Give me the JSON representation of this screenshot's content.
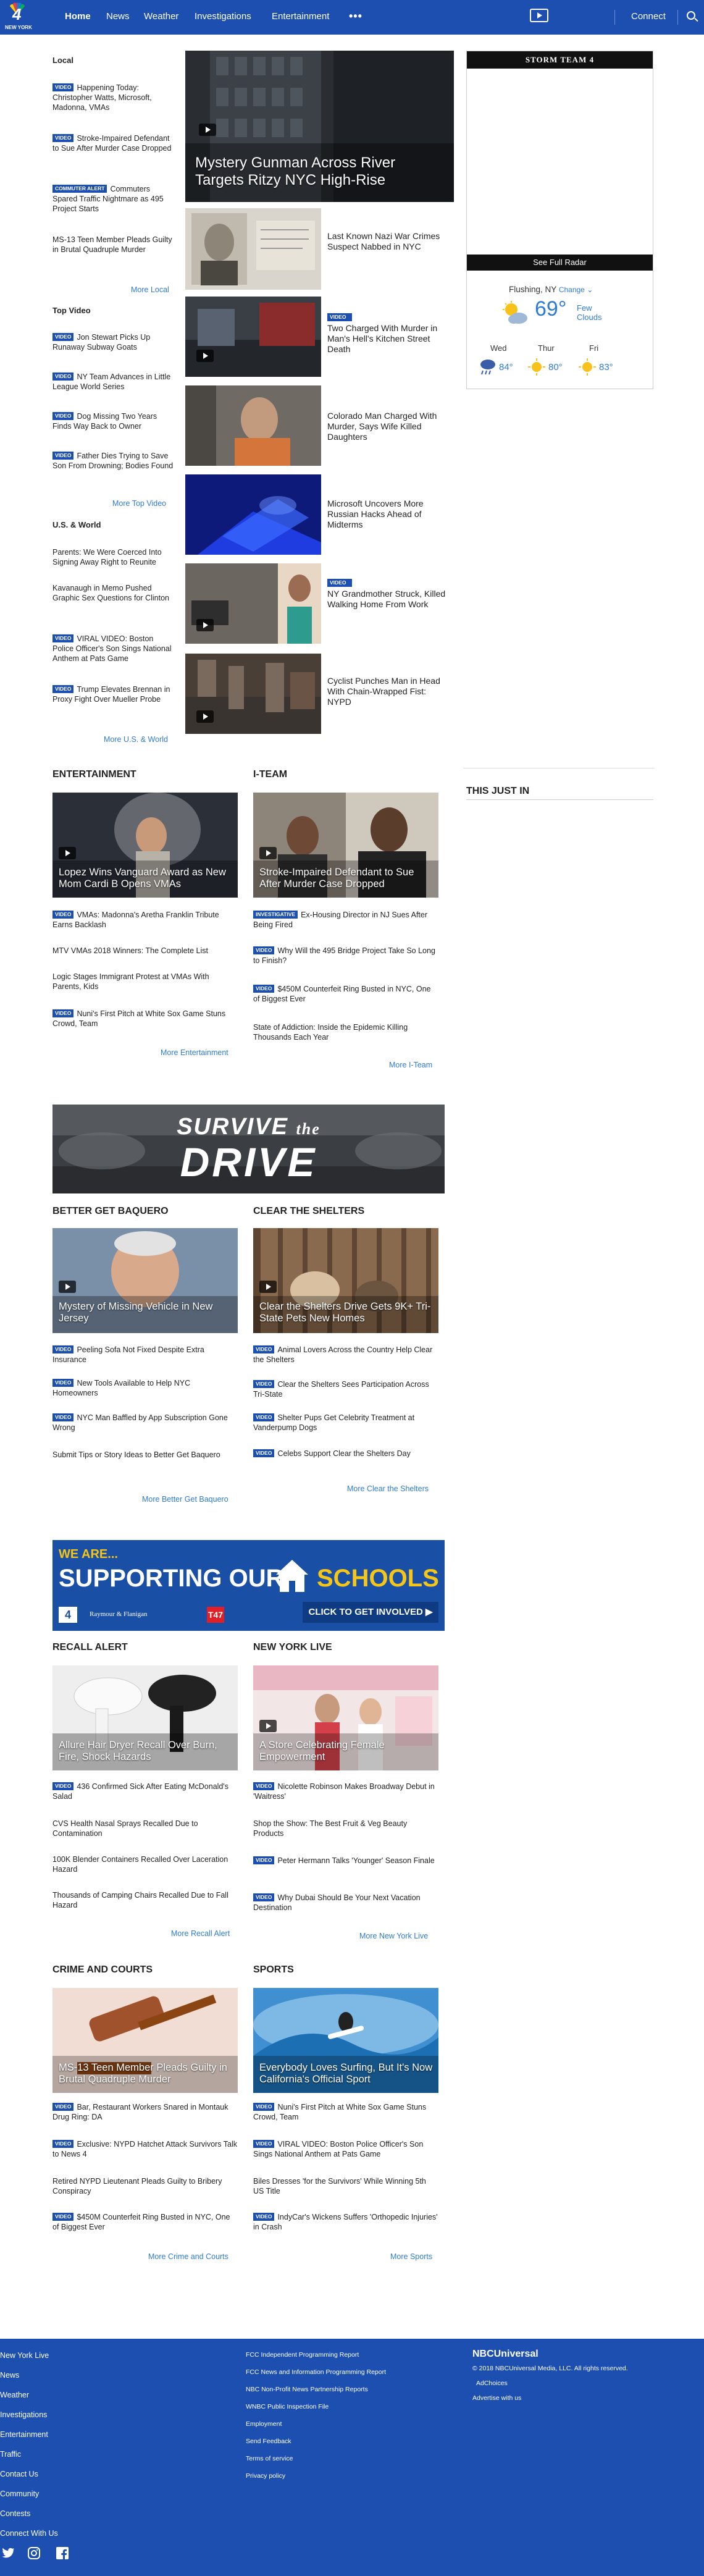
{
  "nav": {
    "logo_text": "NEW YORK",
    "logo_number": "4",
    "links": [
      "Home",
      "News",
      "Weather",
      "Investigations",
      "Entertainment"
    ],
    "more_dots": "•••",
    "connect": "Connect"
  },
  "local": {
    "heading": "Local",
    "items": [
      {
        "tag": "VIDEO",
        "text": "Happening Today: Christopher Watts, Microsoft, Madonna, VMAs"
      },
      {
        "tag": "VIDEO",
        "text": "Stroke-Impaired Defendant to Sue After Murder Case Dropped"
      },
      {
        "tag": "COMMUTER ALERT",
        "text": "Commuters Spared Traffic Nightmare as 495 Project Starts"
      },
      {
        "tag": "",
        "text": "MS-13 Teen Member Pleads Guilty in Brutal Quadruple Murder"
      }
    ],
    "more": "More Local"
  },
  "top_video": {
    "heading": "Top Video",
    "items": [
      {
        "tag": "VIDEO",
        "text": "Jon Stewart Picks Up Runaway Subway Goats"
      },
      {
        "tag": "VIDEO",
        "text": "NY Team Advances in Little League World Series"
      },
      {
        "tag": "VIDEO",
        "text": "Dog Missing Two Years Finds Way Back to Owner"
      },
      {
        "tag": "VIDEO",
        "text": "Father Dies Trying to Save Son From Drowning; Bodies Found"
      }
    ],
    "more": "More Top Video"
  },
  "us_world": {
    "heading": "U.S. & World",
    "items": [
      {
        "tag": "",
        "text": "Parents: We Were Coerced Into Signing Away Right to Reunite"
      },
      {
        "tag": "",
        "text": "Kavanaugh in Memo Pushed Graphic Sex Questions for Clinton"
      },
      {
        "tag": "VIDEO",
        "text": "VIRAL VIDEO: Boston Police Officer's Son Sings National Anthem at Pats Game"
      },
      {
        "tag": "VIDEO",
        "text": "Trump Elevates Brennan in Proxy Fight Over Mueller Probe"
      }
    ],
    "more": "More U.S. & World"
  },
  "hero": {
    "caption": "Mystery Gunman Across River Targets Ritzy NYC High-Rise"
  },
  "side_stories": [
    {
      "tag": "",
      "text": "Last Known Nazi War Crimes Suspect Nabbed in NYC"
    },
    {
      "tag": "VIDEO",
      "text": "Two Charged With Murder in Man's Hell's Kitchen Street Death"
    },
    {
      "tag": "",
      "text": "Colorado Man Charged With Murder, Says Wife Killed Daughters"
    },
    {
      "tag": "",
      "text": "Microsoft Uncovers More Russian Hacks Ahead of Midterms"
    },
    {
      "tag": "VIDEO",
      "text": "NY Grandmother Struck, Killed Walking Home From Work"
    },
    {
      "tag": "",
      "text": "Cyclist Punches Man in Head With Chain-Wrapped Fist: NYPD"
    }
  ],
  "weather": {
    "header": "STORM TEAM 4",
    "radar_button": "See Full Radar",
    "location": "Flushing, NY",
    "change": "Change",
    "temp": "69°",
    "condition_line1": "Few",
    "condition_line2": "Clouds",
    "forecast": [
      {
        "day": "Wed",
        "temp": "84°",
        "icon": "rain-icon"
      },
      {
        "day": "Thur",
        "temp": "80°",
        "icon": "sun-icon"
      },
      {
        "day": "Fri",
        "temp": "83°",
        "icon": "sun-icon"
      }
    ]
  },
  "this_just_in": "THIS JUST IN",
  "entertainment": {
    "heading": "ENTERTAINMENT",
    "caption": "Lopez Wins Vanguard Award as New Mom Cardi B Opens VMAs",
    "items": [
      {
        "tag": "VIDEO",
        "text": "VMAs: Madonna's Aretha Franklin Tribute Earns Backlash"
      },
      {
        "tag": "",
        "text": "MTV VMAs 2018 Winners: The Complete List"
      },
      {
        "tag": "",
        "text": "Logic Stages Immigrant Protest at VMAs With Parents, Kids"
      },
      {
        "tag": "VIDEO",
        "text": "Nuni's First Pitch at White Sox Game Stuns Crowd, Team"
      }
    ],
    "more": "More Entertainment"
  },
  "iteam": {
    "heading": "I-TEAM",
    "caption": "Stroke-Impaired Defendant to Sue After Murder Case Dropped",
    "items": [
      {
        "tag": "INVESTIGATIVE",
        "text": "Ex-Housing Director in NJ Sues After Being Fired"
      },
      {
        "tag": "VIDEO",
        "text": "Why Will the 495 Bridge Project Take So Long to Finish?"
      },
      {
        "tag": "VIDEO",
        "text": "$450M Counterfeit Ring Busted in NYC, One of Biggest Ever"
      },
      {
        "tag": "",
        "text": "State of Addiction: Inside the Epidemic Killing Thousands Each Year"
      }
    ],
    "more": "More I-Team"
  },
  "drive_banner": {
    "line1": "SURVIVE",
    "line2": "the",
    "line3": "DRIVE"
  },
  "baquero": {
    "heading": "BETTER GET BAQUERO",
    "caption": "Mystery of Missing Vehicle in New Jersey",
    "items": [
      {
        "tag": "VIDEO",
        "text": "Peeling Sofa Not Fixed Despite Extra Insurance"
      },
      {
        "tag": "VIDEO",
        "text": "New Tools Available to Help NYC Homeowners"
      },
      {
        "tag": "VIDEO",
        "text": "NYC Man Baffled by App Subscription Gone Wrong"
      },
      {
        "tag": "",
        "text": "Submit Tips or Story Ideas to Better Get Baquero"
      }
    ],
    "more": "More Better Get Baquero"
  },
  "shelters": {
    "heading": "CLEAR THE SHELTERS",
    "caption": "Clear the Shelters Drive Gets 9K+ Tri-State Pets New Homes",
    "items": [
      {
        "tag": "VIDEO",
        "text": "Animal Lovers Across the Country Help Clear the Shelters"
      },
      {
        "tag": "VIDEO",
        "text": "Clear the Shelters Sees Participation Across Tri-State"
      },
      {
        "tag": "VIDEO",
        "text": "Shelter Pups Get Celebrity Treatment at Vanderpump Dogs"
      },
      {
        "tag": "VIDEO",
        "text": "Celebs Support Clear the Shelters Day"
      }
    ],
    "more": "More Clear the Shelters"
  },
  "schools_banner": {
    "line1": "WE ARE...",
    "line2": "SUPPORTING OUR",
    "line3": "SCHOOLS",
    "sponsor": "Raymour & Flanigan",
    "cta": "CLICK TO GET INVOLVED ▶"
  },
  "recall": {
    "heading": "RECALL ALERT",
    "caption": "Allure Hair Dryer Recall Over Burn, Fire, Shock Hazards",
    "items": [
      {
        "tag": "VIDEO",
        "text": "436 Confirmed Sick After Eating McDonald's Salad"
      },
      {
        "tag": "",
        "text": "CVS Health Nasal Sprays Recalled Due to Contamination"
      },
      {
        "tag": "",
        "text": "100K Blender Containers Recalled Over Laceration Hazard"
      },
      {
        "tag": "",
        "text": "Thousands of Camping Chairs Recalled Due to Fall Hazard"
      }
    ],
    "more": "More Recall Alert"
  },
  "nylive": {
    "heading": "NEW YORK LIVE",
    "caption": "A Store Celebrating Female Empowerment",
    "items": [
      {
        "tag": "VIDEO",
        "text": "Nicolette Robinson Makes Broadway Debut in 'Waitress'"
      },
      {
        "tag": "",
        "text": "Shop the Show: The Best Fruit & Veg Beauty Products"
      },
      {
        "tag": "VIDEO",
        "text": "Peter Hermann Talks 'Younger' Season Finale"
      },
      {
        "tag": "VIDEO",
        "text": "Why Dubai Should Be Your Next Vacation Destination"
      }
    ],
    "more": "More New York Live"
  },
  "crime": {
    "heading": "CRIME AND COURTS",
    "caption": "MS-13 Teen Member Pleads Guilty in Brutal Quadruple Murder",
    "items": [
      {
        "tag": "VIDEO",
        "text": "Bar, Restaurant Workers Snared in Montauk Drug Ring: DA"
      },
      {
        "tag": "VIDEO",
        "text": "Exclusive: NYPD Hatchet Attack Survivors Talk to News 4"
      },
      {
        "tag": "",
        "text": "Retired NYPD Lieutenant Pleads Guilty to Bribery Conspiracy"
      },
      {
        "tag": "VIDEO",
        "text": "$450M Counterfeit Ring Busted in NYC, One of Biggest Ever"
      }
    ],
    "more": "More Crime and Courts"
  },
  "sports": {
    "heading": "SPORTS",
    "caption": "Everybody Loves Surfing, But It's Now California's Official Sport",
    "items": [
      {
        "tag": "VIDEO",
        "text": "Nuni's First Pitch at White Sox Game Stuns Crowd, Team"
      },
      {
        "tag": "VIDEO",
        "text": "VIRAL VIDEO: Boston Police Officer's Son Sings National Anthem at Pats Game"
      },
      {
        "tag": "",
        "text": "Biles Dresses 'for the Survivors' While Winning 5th US Title"
      },
      {
        "tag": "VIDEO",
        "text": "IndyCar's Wickens Suffers 'Orthopedic Injuries' in Crash"
      }
    ],
    "more": "More Sports"
  },
  "footer": {
    "col1": [
      "New York Live",
      "News",
      "Weather",
      "Investigations",
      "Entertainment",
      "Traffic",
      "Contact Us",
      "Community",
      "Contests",
      "Connect With Us"
    ],
    "col2": [
      "FCC Independent Programming Report",
      "FCC News and Information Programming Report",
      "NBC Non-Profit News Partnership Reports",
      "WNBC Public Inspection File",
      "Employment",
      "Send Feedback",
      "Terms of service",
      "Privacy policy"
    ],
    "brand": "NBCUniversal",
    "copyright": "© 2018 NBCUniversal Media, LLC. All rights reserved.",
    "adchoices": "AdChoices",
    "advertise": "Advertise with us"
  }
}
